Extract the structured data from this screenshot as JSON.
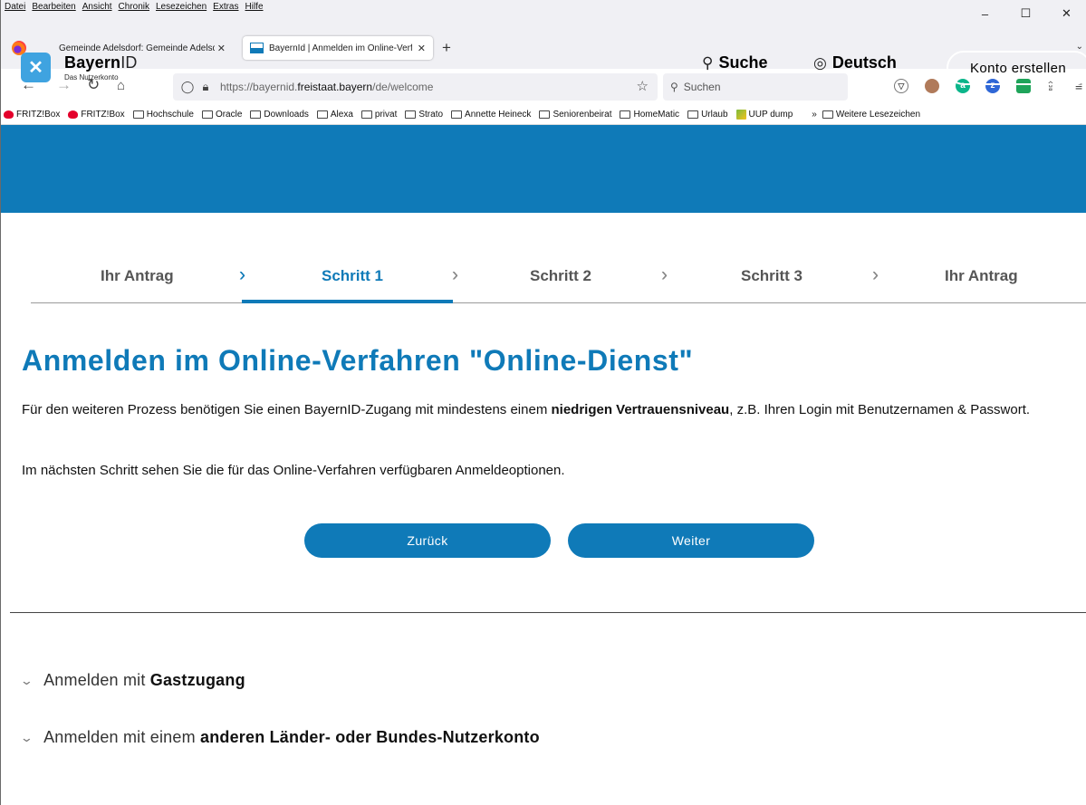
{
  "browser": {
    "menu": [
      "Datei",
      "Bearbeiten",
      "Ansicht",
      "Chronik",
      "Lesezeichen",
      "Extras",
      "Hilfe"
    ],
    "window_controls": {
      "minimize": "–",
      "maximize": "☐",
      "close": "✕"
    },
    "tabs": [
      {
        "title": "Gemeinde Adelsdorf: Gemeinde Adelsdorf",
        "close": "✕"
      },
      {
        "title": "BayernId | Anmelden im Online-Verfahren",
        "close": "✕"
      }
    ],
    "new_tab": "+",
    "url_prefix": "https://bayernid.",
    "url_domain": "freistaat.bayern",
    "url_path": "/de/welcome",
    "search_placeholder": "Suchen",
    "bookmarks": [
      "FRITZ!Box",
      "FRITZ!Box",
      "Hochschule",
      "Oracle",
      "Downloads",
      "Alexa",
      "privat",
      "Strato",
      "Annette Heineck",
      "Seniorenbeirat",
      "HomeMatic",
      "Urlaub",
      "UUP dump"
    ],
    "bookmarks_more": "»",
    "bookmarks_other": "Weitere Lesezeichen"
  },
  "header": {
    "brand": "Bayern",
    "brand_id": "ID",
    "subtitle": "Das Nutzerkonto",
    "search": "Suche",
    "language": "Deutsch",
    "account": "Konto erstellen",
    "color": "#0f7ab8"
  },
  "steps": {
    "items": [
      "Ihr Antrag",
      "Schritt 1",
      "Schritt 2",
      "Schritt 3",
      "Ihr Antrag"
    ],
    "active": "Schritt 1"
  },
  "main": {
    "title": "Anmelden im Online-Verfahren \"Online-Dienst\"",
    "para1_before": "Für den weiteren Prozess benötigen Sie einen BayernID-Zugang mit mindestens einem ",
    "para1_bold": "niedrigen Vertrauensniveau",
    "para1_after": ", z.B. Ihren Login mit Benutzernamen & Passwort.",
    "para2": "Im nächsten Schritt sehen Sie die für das Online-Verfahren verfügbaren Anmeldeoptionen.",
    "back_button": "Zurück",
    "next_button": "Weiter"
  },
  "accordion": [
    {
      "prefix": "Anmelden mit ",
      "bold": "Gastzugang"
    },
    {
      "prefix": "Anmelden mit einem ",
      "bold": "anderen Länder- oder Bundes-Nutzerkonto"
    }
  ]
}
